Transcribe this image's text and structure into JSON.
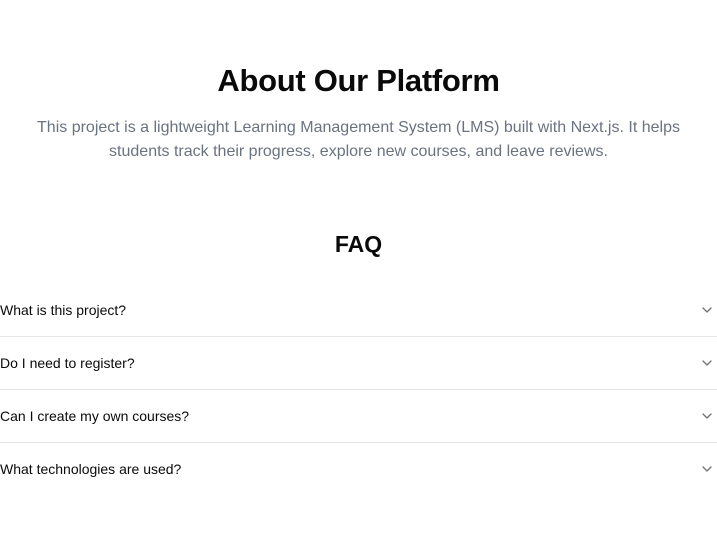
{
  "about": {
    "title": "About Our Platform",
    "description": "This project is a lightweight Learning Management System (LMS) built with Next.js. It helps students track their progress, explore new courses, and leave reviews."
  },
  "faq": {
    "title": "FAQ",
    "items": [
      {
        "question": "What is this project?",
        "icon": "chevron-down-icon"
      },
      {
        "question": "Do I need to register?",
        "icon": "chevron-down-icon"
      },
      {
        "question": "Can I create my own courses?",
        "icon": "chevron-down-icon"
      },
      {
        "question": "What technologies are used?",
        "icon": "chevron-down-icon"
      }
    ]
  },
  "colors": {
    "heading": "#0a0a0a",
    "body_text": "#6b7280",
    "divider": "#e5e7eb",
    "icon": "#737373"
  }
}
